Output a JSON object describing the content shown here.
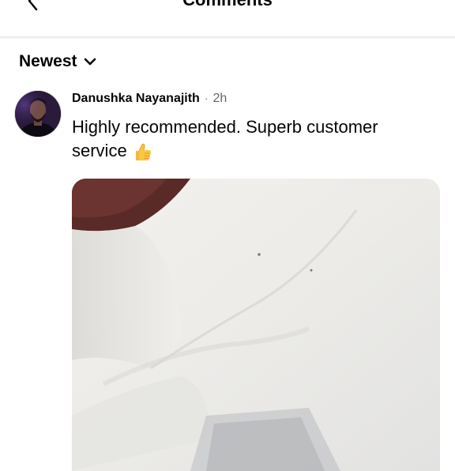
{
  "header": {
    "title": "Comments",
    "back_icon": "chevron-left-icon"
  },
  "sort": {
    "label": "Newest",
    "icon": "chevron-down-icon"
  },
  "comments": [
    {
      "author": "Danushka Nayanajith",
      "separator": "·",
      "time": "2h",
      "text": "Highly recommended. Superb customer service",
      "emoji": "thumbs-up-emoji",
      "attachment": "photo"
    }
  ],
  "colors": {
    "text": "#050505",
    "secondary_text": "#65676b",
    "divider": "#e4e6eb"
  }
}
